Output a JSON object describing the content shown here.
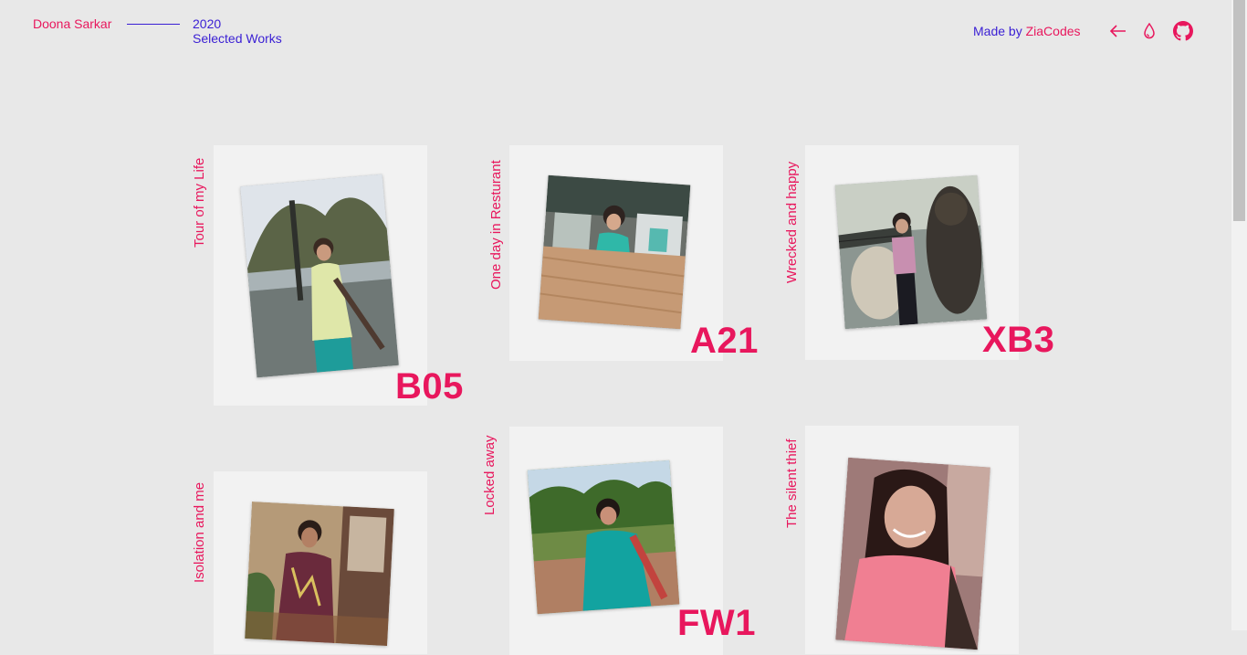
{
  "header": {
    "author": "Doona Sarkar",
    "year": "2020",
    "subtitle": "Selected Works",
    "made_by_prefix": "Made by",
    "made_by_name": "ZiaCodes",
    "icons": [
      "arrow-left-icon",
      "water-drop-icon",
      "github-icon"
    ]
  },
  "accent_color": "#e8175d",
  "secondary_color": "#3a1fd4",
  "works": [
    {
      "label": "Tour of my Life",
      "code": "B05"
    },
    {
      "label": "One day in Resturant",
      "code": "A21"
    },
    {
      "label": "Wrecked and happy",
      "code": "XB3"
    },
    {
      "label": "Isolation and me",
      "code": ""
    },
    {
      "label": "Locked away",
      "code": "FW1"
    },
    {
      "label": "The silent thief",
      "code": ""
    }
  ]
}
